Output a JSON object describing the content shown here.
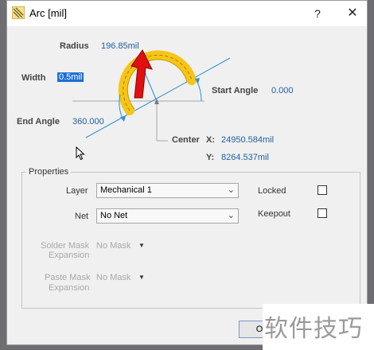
{
  "window": {
    "title": "Arc [mil]",
    "help_glyph": "?",
    "close_glyph": "✕",
    "icon": "arc-dialog-icon"
  },
  "diagram": {
    "radius_label": "Radius",
    "radius_value": "196.85mil",
    "width_label": "Width",
    "width_value": "0.5mil",
    "start_angle_label": "Start Angle",
    "start_angle_value": "0.000",
    "end_angle_label": "End Angle",
    "end_angle_value": "360.000",
    "center_label": "Center",
    "x_label": "X:",
    "x_value": "24950.584mil",
    "y_label": "Y:",
    "y_value": "8264.537mil",
    "colors": {
      "arc": "#f5c518",
      "guide": "#2a8fd6",
      "pointer": "#e01010"
    }
  },
  "properties": {
    "group_title": "Properties",
    "layer_label": "Layer",
    "layer_value": "Mechanical 1",
    "net_label": "Net",
    "net_value": "No Net",
    "locked_label": "Locked",
    "locked_checked": false,
    "keepout_label": "Keepout",
    "keepout_checked": false,
    "solder_mask_label_1": "Solder Mask",
    "solder_mask_label_2": "Expansion",
    "solder_mask_value": "No Mask",
    "paste_mask_label_1": "Paste Mask",
    "paste_mask_label_2": "Expansion",
    "paste_mask_value": "No Mask"
  },
  "footer": {
    "ok_label": "O"
  },
  "watermark": {
    "text": "软件技巧"
  }
}
